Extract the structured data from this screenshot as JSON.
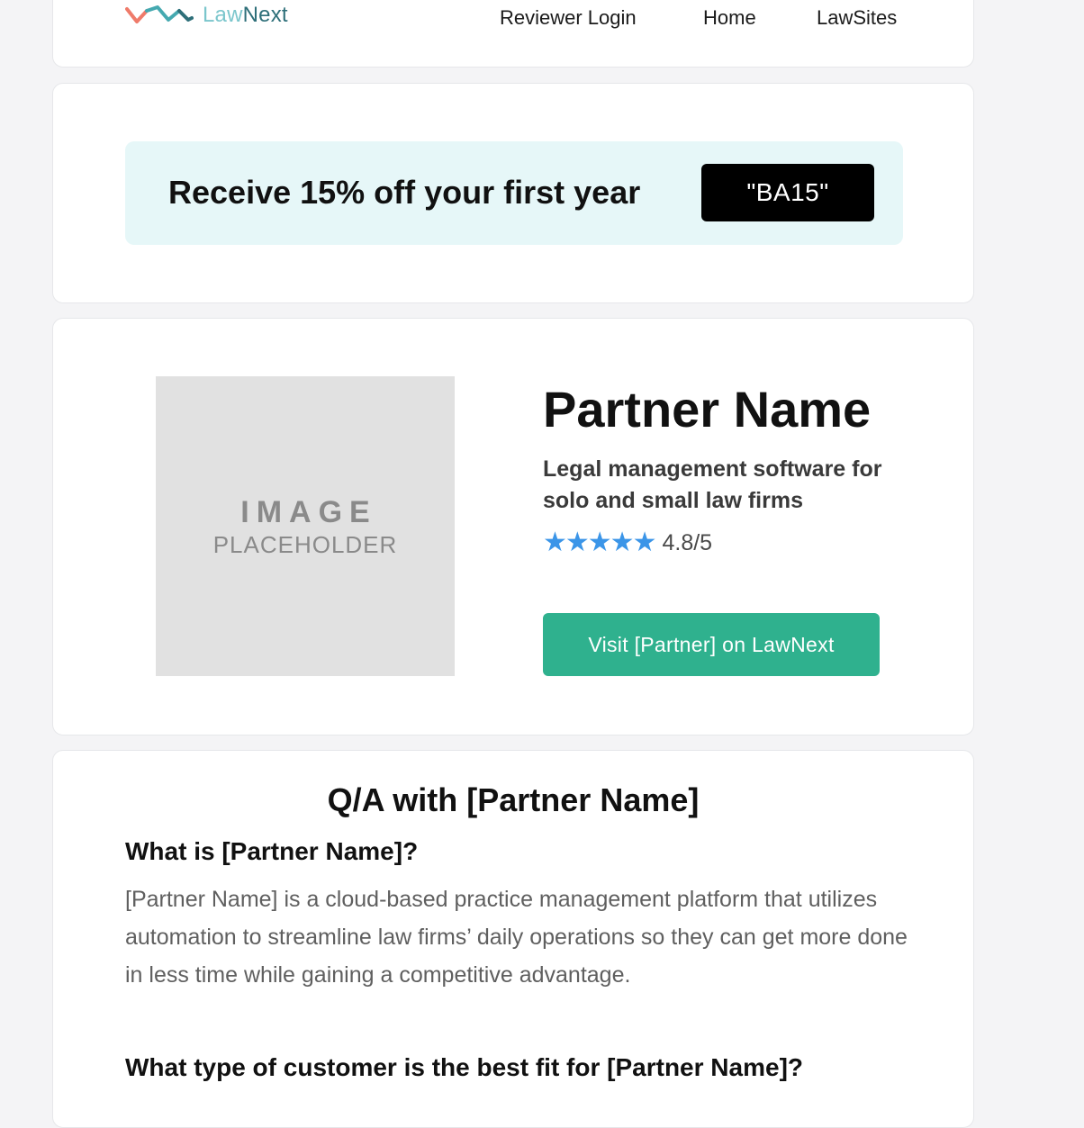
{
  "header": {
    "logo_law": "Law",
    "logo_next": "Next",
    "nav": [
      "Reviewer Login",
      "Home",
      "LawSites"
    ]
  },
  "promo": {
    "text": "Receive 15% off your first year",
    "code": "\"BA15\""
  },
  "partner": {
    "placeholder_line1": "IMAGE",
    "placeholder_line2": "PLACEHOLDER",
    "name": "Partner Name",
    "description": "Legal management software for solo and small law firms",
    "stars": "★★★★★",
    "rating": "4.8/5",
    "rating_value": 4.8,
    "visit_button": "Visit [Partner] on LawNext"
  },
  "qa": {
    "title": "Q/A with [Partner Name]",
    "items": [
      {
        "question": "What is [Partner Name]?",
        "answer": "[Partner Name] is a cloud-based practice management platform that utilizes automation to streamline law firms’ daily operations so they can get more done in less time while gaining a competitive advantage."
      },
      {
        "question": "What type of customer is the best fit for [Partner Name]?"
      }
    ]
  },
  "colors": {
    "accent_green": "#2fb18e",
    "promo_bg": "#e6f7f8",
    "star_blue": "#3b95e8",
    "logo_coral": "#ef7b6a",
    "logo_teal": "#45a9b0"
  }
}
